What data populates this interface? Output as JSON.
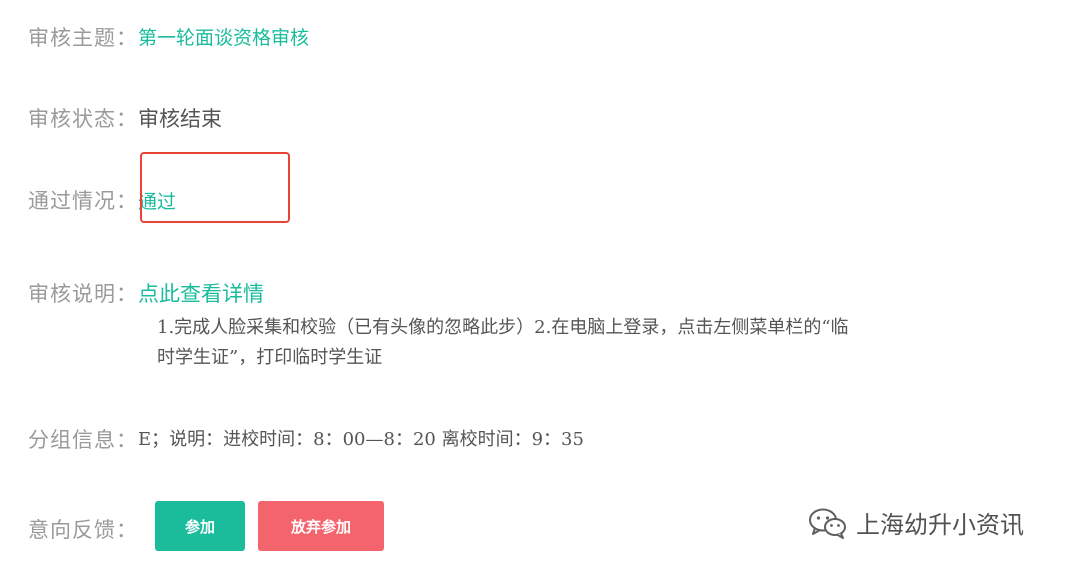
{
  "review": {
    "topic_label": "审核主题：",
    "topic_value": "第一轮面谈资格审核",
    "status_label": "审核状态：",
    "status_value": "审核结束",
    "result_label": "通过情况：",
    "result_value": "通过",
    "explain_label": "审核说明：",
    "explain_link": "点此查看详情",
    "explain_text_line1": "1.完成人脸采集和校验（已有头像的忽略此步）2.在电脑上登录，点击左侧菜单栏的“临",
    "explain_text_line2": "时学生证”，打印临时学生证",
    "group_label": "分组信息：",
    "group_value": "E；说明：进校时间：8：00—8：20 离校时间：9：35",
    "intent_label": "意向反馈："
  },
  "buttons": {
    "join": "参加",
    "give_up": "放弃参加"
  },
  "watermark": {
    "text": "上海幼升小资讯",
    "icon": "wechat-icon"
  },
  "colors": {
    "accent": "#1abc9c",
    "danger": "#f4646d",
    "highlight": "#e8443a"
  }
}
